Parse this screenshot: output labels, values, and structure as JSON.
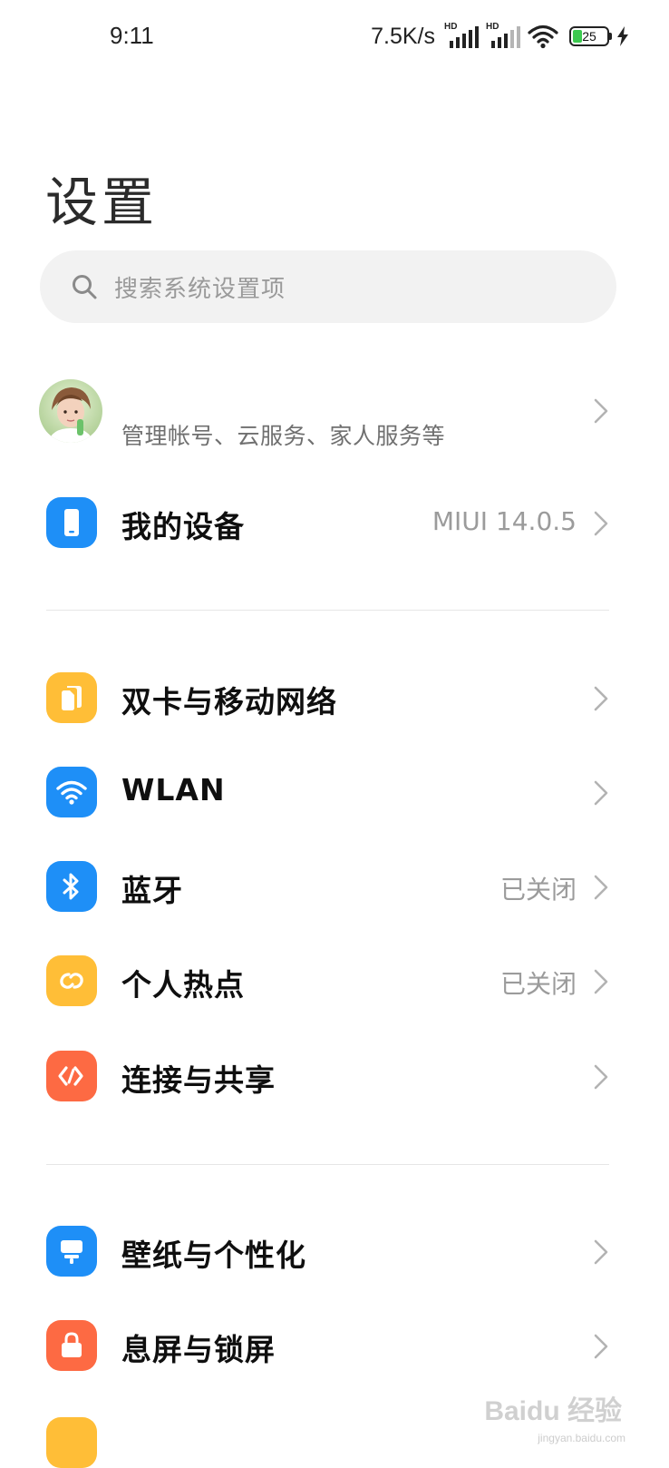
{
  "status_bar": {
    "time": "9:11",
    "net_speed": "7.5K/s",
    "sim1_badge": "HD",
    "sim2_badge": "HD",
    "battery_level": "25",
    "battery_color": "#3cc94f",
    "charging": true
  },
  "page": {
    "title": "设置"
  },
  "search": {
    "placeholder": "搜索系统设置项",
    "icon": "search-icon"
  },
  "account": {
    "subtitle": "管理帐号、云服务、家人服务等"
  },
  "device": {
    "label": "我的设备",
    "value": "MIUI 14.0.5",
    "icon": "phone-icon",
    "icon_color": "#1e8ff7"
  },
  "connectivity": [
    {
      "label": "双卡与移动网络",
      "value": "",
      "icon": "sim-card-icon",
      "icon_color": "#ffbe37"
    },
    {
      "label": "WLAN",
      "value": "",
      "icon": "wifi-icon",
      "icon_color": "#1e8ff7"
    },
    {
      "label": "蓝牙",
      "value": "已关闭",
      "icon": "bluetooth-icon",
      "icon_color": "#1e8ff7"
    },
    {
      "label": "个人热点",
      "value": "已关闭",
      "icon": "hotspot-icon",
      "icon_color": "#ffbe37"
    },
    {
      "label": "连接与共享",
      "value": "",
      "icon": "share-icon",
      "icon_color": "#fd6a43"
    }
  ],
  "personalization": [
    {
      "label": "壁纸与个性化",
      "value": "",
      "icon": "wallpaper-icon",
      "icon_color": "#1e8ff7"
    },
    {
      "label": "息屏与锁屏",
      "value": "",
      "icon": "lock-icon",
      "icon_color": "#fd6a43"
    }
  ],
  "watermark": {
    "text": "Baidu 经验",
    "sub": "jingyan.baidu.com"
  }
}
